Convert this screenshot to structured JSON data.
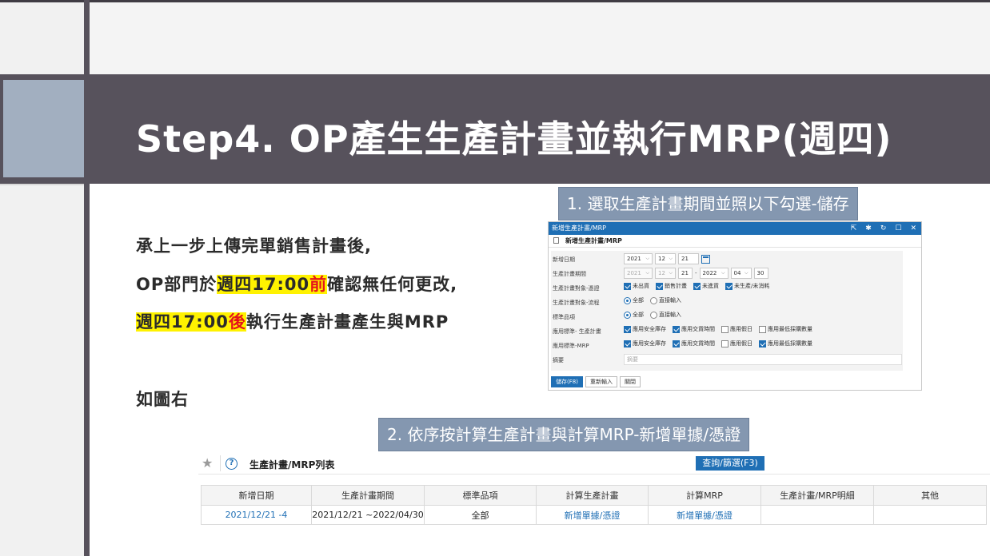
{
  "slide": {
    "title": "Step4. OP產生生產計畫並執行MRP(週四)",
    "body": {
      "line1": "承上一步上傳完單銷售計畫後,",
      "line2_a": "OP部門於",
      "line2_hl": "週四17:00",
      "line2_red": "前",
      "line2_b": "確認無任何更改,",
      "line3_hl": "週四17:00",
      "line3_red": "後",
      "line3_b": "執行生產計畫產生與MRP",
      "line4": "如圖右"
    },
    "callout1": "1. 選取生產計畫期間並照以下勾選-儲存",
    "callout2": "2. 依序按計算生產計畫與計算MRP-新增單據/憑證",
    "colors": {
      "header": "#57525c",
      "accent": "#a2afc0",
      "callout": "#8497b0",
      "highlight": "#fff200",
      "red": "#e5141a",
      "primary": "#1f6fb5"
    }
  },
  "dialog": {
    "window_title": "新增生產計畫/MRP",
    "subtitle": "新增生產計畫/MRP",
    "tool_icons": [
      "external-link-icon",
      "pin-icon",
      "refresh-icon",
      "maximize-icon",
      "close-icon"
    ],
    "fields": {
      "add_date": {
        "label": "新增日期",
        "year": "2021",
        "month": "12",
        "day": "21"
      },
      "period": {
        "label": "生產計畫期間",
        "from_year": "2021",
        "from_month": "12",
        "from_day": "21",
        "dash": "-",
        "to_year": "2022",
        "to_month": "04",
        "to_day": "30"
      },
      "target_voucher": {
        "label": "生產計畫對象-憑證",
        "options": [
          "未出貨",
          "銷售計畫",
          "未進貨",
          "未生產/未消耗"
        ]
      },
      "target_process": {
        "label": "生產計畫對象-流程",
        "options": [
          "全部",
          "直接輸入"
        ]
      },
      "std_item": {
        "label": "標準品項",
        "options": [
          "全部",
          "直接輸入"
        ]
      },
      "apply_plan": {
        "label": "應用標準- 生產計畫",
        "options": [
          "應用安全庫存",
          "應用交貨時間",
          "應用假日",
          "應用最低採購數量"
        ]
      },
      "apply_mrp": {
        "label": "應用標準-MRP",
        "options": [
          "應用安全庫存",
          "應用交貨時間",
          "應用假日",
          "應用最低採購數量"
        ]
      },
      "memo": {
        "label": "摘要",
        "placeholder": "摘要"
      }
    },
    "buttons": {
      "save": "儲存(F8)",
      "reset": "重新輸入",
      "close": "關閉"
    }
  },
  "list": {
    "title": "生產計畫/MRP列表",
    "query_button": "查詢/篩選(F3)",
    "columns": [
      "新增日期",
      "生產計畫期間",
      "標準品項",
      "計算生產計畫",
      "計算MRP",
      "生產計畫/MRP明細",
      "其他"
    ],
    "rows": [
      [
        "2021/12/21 -4",
        "2021/12/21 ~2022/04/30",
        "全部",
        "新增單據/憑證",
        "新增單據/憑證",
        "",
        ""
      ]
    ]
  }
}
